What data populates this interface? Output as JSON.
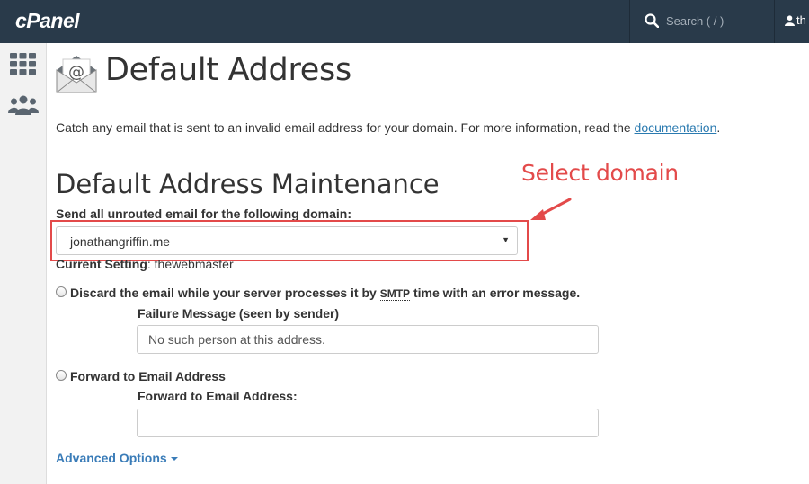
{
  "topbar": {
    "logo": "cPanel",
    "search_placeholder": "Search ( / )",
    "user_name": "th"
  },
  "sidebar": {
    "items": [
      {
        "icon": "grid-icon"
      },
      {
        "icon": "users-icon"
      }
    ]
  },
  "page": {
    "title": "Default Address",
    "intro_text": "Catch any email that is sent to an invalid email address for your domain. For more information, read the ",
    "intro_link": "documentation",
    "intro_end": "."
  },
  "maintenance": {
    "title": "Default Address Maintenance",
    "domain_label": "Send all unrouted email for the following domain:",
    "domain_value": "jonathangriffin.me",
    "current_label": "Current Setting",
    "current_value": ": thewebmaster",
    "discard_label_pre": "Discard the email while your server processes it by ",
    "discard_smtp": "SMTP",
    "discard_label_post": " time with an error message.",
    "failure_label": "Failure Message (seen by sender)",
    "failure_placeholder": "No such person at this address.",
    "forward_radio_label": "Forward to Email Address",
    "forward_field_label": "Forward to Email Address:",
    "forward_value": "",
    "advanced_options": "Advanced Options"
  },
  "annotation": {
    "text": "Select domain",
    "color": "#e34a4a"
  },
  "colors": {
    "topbar": "#293a4a",
    "link": "#2a7ab0",
    "accent": "#3a7cb8"
  }
}
